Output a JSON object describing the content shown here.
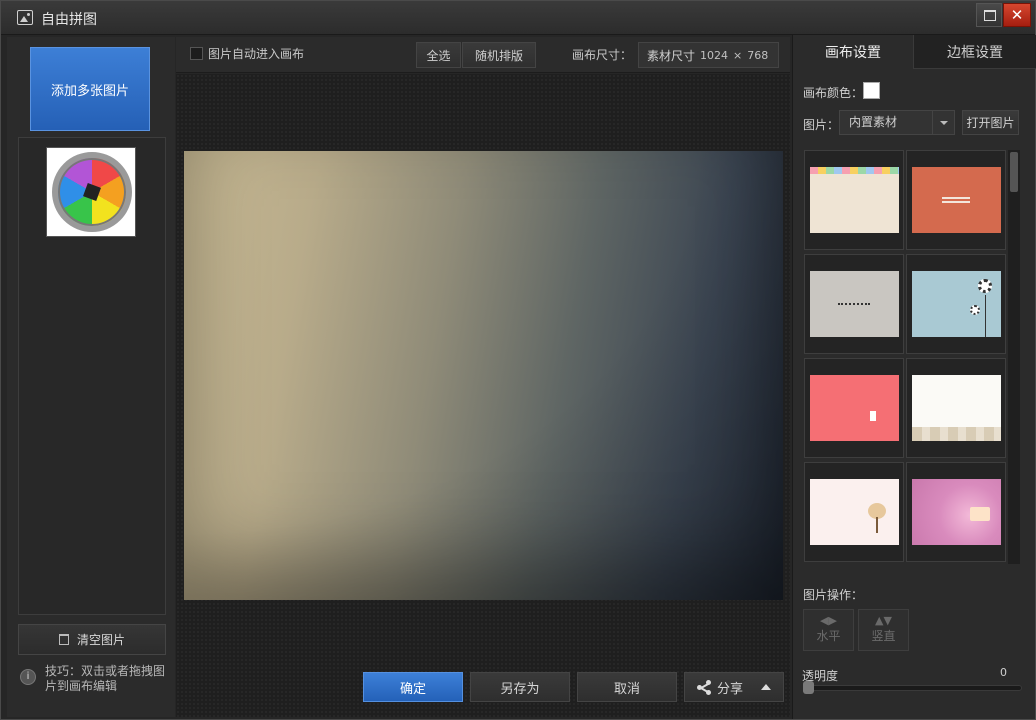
{
  "window": {
    "title": "自由拼图"
  },
  "left": {
    "add_label": "添加多张图片",
    "clear_label": "清空图片",
    "tip_icon": "i",
    "tip": "技巧：双击或者拖拽图片到画布编辑"
  },
  "toolbar": {
    "auto_enter_label": "图片自动进入画布",
    "select_all_label": "全选",
    "random_label": "随机排版",
    "size_label": "画布尺寸：",
    "size_mode": "素材尺寸",
    "width": "1024",
    "times": "×",
    "height": "768"
  },
  "actions": {
    "ok": "确定",
    "save_as": "另存为",
    "cancel": "取消",
    "share": "分享"
  },
  "right": {
    "tabs": [
      {
        "label": "画布设置",
        "active": true
      },
      {
        "label": "边框设置",
        "active": false
      }
    ],
    "color_label": "画布颜色：",
    "canvas_color": "#ffffff",
    "image_label": "图片：",
    "image_select": "内置素材",
    "open_label": "打开图片",
    "ops_label": "图片操作：",
    "horizontal_label": "水平",
    "vertical_label": "竖直",
    "opacity_label": "透明度",
    "opacity_value": "0"
  },
  "colors": {
    "accent": "#2e6fc9",
    "close": "#c0321c"
  }
}
